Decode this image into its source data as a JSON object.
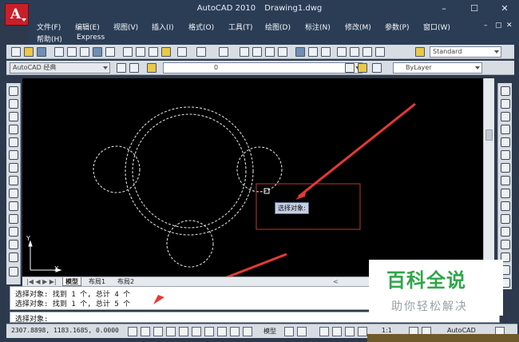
{
  "app": {
    "name": "AutoCAD 2010",
    "file": "Drawing1.dwg",
    "logo_letter": "A"
  },
  "window_controls": {
    "minimize": "–",
    "maximize": "☐",
    "close": "✕"
  },
  "menus": [
    "文件(F)",
    "编辑(E)",
    "视图(V)",
    "插入(I)",
    "格式(O)",
    "工具(T)",
    "绘图(D)",
    "标注(N)",
    "修改(M)",
    "参数(P)",
    "窗口(W)",
    "帮助(H)",
    "Express"
  ],
  "inner_controls": {
    "minimize": "–",
    "restore": "▢",
    "close": "✕"
  },
  "toolbar": {
    "text_style": "Standard",
    "workspace": "AutoCAD 经典",
    "layer": "0",
    "linetype": "ByLayer"
  },
  "tabs": [
    "模型",
    "布局1",
    "布局2"
  ],
  "canvas": {
    "tooltip": "选择对象:",
    "axis_y": "Y",
    "axis_x": "X"
  },
  "command": {
    "history": [
      "选择对象: 找到 1 个, 总计 4 个",
      "选择对象: 找到 1 个, 总计 5 个"
    ],
    "prompt": "选择对象:"
  },
  "status": {
    "coordinates": "2307.8898, 1183.1685, 0.0000",
    "model_label": "模型",
    "scale": "1:1",
    "workspace_btn": "AutoCAD"
  },
  "watermark": {
    "title": "百科全说",
    "subtitle": "助你轻松解决"
  },
  "colors": {
    "title_bar": "#2b3d55",
    "canvas": "#000000",
    "highlight_box": "#c0392b",
    "arrow": "#e53935",
    "watermark_green": "#2fa64a"
  }
}
